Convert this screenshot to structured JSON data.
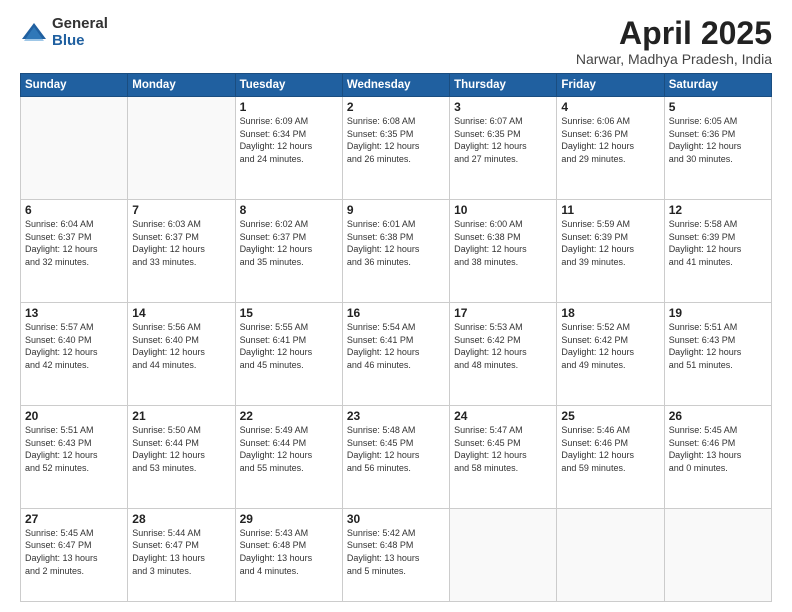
{
  "logo": {
    "general": "General",
    "blue": "Blue"
  },
  "header": {
    "title": "April 2025",
    "location": "Narwar, Madhya Pradesh, India"
  },
  "days_of_week": [
    "Sunday",
    "Monday",
    "Tuesday",
    "Wednesday",
    "Thursday",
    "Friday",
    "Saturday"
  ],
  "weeks": [
    [
      {
        "day": "",
        "info": ""
      },
      {
        "day": "",
        "info": ""
      },
      {
        "day": "1",
        "info": "Sunrise: 6:09 AM\nSunset: 6:34 PM\nDaylight: 12 hours\nand 24 minutes."
      },
      {
        "day": "2",
        "info": "Sunrise: 6:08 AM\nSunset: 6:35 PM\nDaylight: 12 hours\nand 26 minutes."
      },
      {
        "day": "3",
        "info": "Sunrise: 6:07 AM\nSunset: 6:35 PM\nDaylight: 12 hours\nand 27 minutes."
      },
      {
        "day": "4",
        "info": "Sunrise: 6:06 AM\nSunset: 6:36 PM\nDaylight: 12 hours\nand 29 minutes."
      },
      {
        "day": "5",
        "info": "Sunrise: 6:05 AM\nSunset: 6:36 PM\nDaylight: 12 hours\nand 30 minutes."
      }
    ],
    [
      {
        "day": "6",
        "info": "Sunrise: 6:04 AM\nSunset: 6:37 PM\nDaylight: 12 hours\nand 32 minutes."
      },
      {
        "day": "7",
        "info": "Sunrise: 6:03 AM\nSunset: 6:37 PM\nDaylight: 12 hours\nand 33 minutes."
      },
      {
        "day": "8",
        "info": "Sunrise: 6:02 AM\nSunset: 6:37 PM\nDaylight: 12 hours\nand 35 minutes."
      },
      {
        "day": "9",
        "info": "Sunrise: 6:01 AM\nSunset: 6:38 PM\nDaylight: 12 hours\nand 36 minutes."
      },
      {
        "day": "10",
        "info": "Sunrise: 6:00 AM\nSunset: 6:38 PM\nDaylight: 12 hours\nand 38 minutes."
      },
      {
        "day": "11",
        "info": "Sunrise: 5:59 AM\nSunset: 6:39 PM\nDaylight: 12 hours\nand 39 minutes."
      },
      {
        "day": "12",
        "info": "Sunrise: 5:58 AM\nSunset: 6:39 PM\nDaylight: 12 hours\nand 41 minutes."
      }
    ],
    [
      {
        "day": "13",
        "info": "Sunrise: 5:57 AM\nSunset: 6:40 PM\nDaylight: 12 hours\nand 42 minutes."
      },
      {
        "day": "14",
        "info": "Sunrise: 5:56 AM\nSunset: 6:40 PM\nDaylight: 12 hours\nand 44 minutes."
      },
      {
        "day": "15",
        "info": "Sunrise: 5:55 AM\nSunset: 6:41 PM\nDaylight: 12 hours\nand 45 minutes."
      },
      {
        "day": "16",
        "info": "Sunrise: 5:54 AM\nSunset: 6:41 PM\nDaylight: 12 hours\nand 46 minutes."
      },
      {
        "day": "17",
        "info": "Sunrise: 5:53 AM\nSunset: 6:42 PM\nDaylight: 12 hours\nand 48 minutes."
      },
      {
        "day": "18",
        "info": "Sunrise: 5:52 AM\nSunset: 6:42 PM\nDaylight: 12 hours\nand 49 minutes."
      },
      {
        "day": "19",
        "info": "Sunrise: 5:51 AM\nSunset: 6:43 PM\nDaylight: 12 hours\nand 51 minutes."
      }
    ],
    [
      {
        "day": "20",
        "info": "Sunrise: 5:51 AM\nSunset: 6:43 PM\nDaylight: 12 hours\nand 52 minutes."
      },
      {
        "day": "21",
        "info": "Sunrise: 5:50 AM\nSunset: 6:44 PM\nDaylight: 12 hours\nand 53 minutes."
      },
      {
        "day": "22",
        "info": "Sunrise: 5:49 AM\nSunset: 6:44 PM\nDaylight: 12 hours\nand 55 minutes."
      },
      {
        "day": "23",
        "info": "Sunrise: 5:48 AM\nSunset: 6:45 PM\nDaylight: 12 hours\nand 56 minutes."
      },
      {
        "day": "24",
        "info": "Sunrise: 5:47 AM\nSunset: 6:45 PM\nDaylight: 12 hours\nand 58 minutes."
      },
      {
        "day": "25",
        "info": "Sunrise: 5:46 AM\nSunset: 6:46 PM\nDaylight: 12 hours\nand 59 minutes."
      },
      {
        "day": "26",
        "info": "Sunrise: 5:45 AM\nSunset: 6:46 PM\nDaylight: 13 hours\nand 0 minutes."
      }
    ],
    [
      {
        "day": "27",
        "info": "Sunrise: 5:45 AM\nSunset: 6:47 PM\nDaylight: 13 hours\nand 2 minutes."
      },
      {
        "day": "28",
        "info": "Sunrise: 5:44 AM\nSunset: 6:47 PM\nDaylight: 13 hours\nand 3 minutes."
      },
      {
        "day": "29",
        "info": "Sunrise: 5:43 AM\nSunset: 6:48 PM\nDaylight: 13 hours\nand 4 minutes."
      },
      {
        "day": "30",
        "info": "Sunrise: 5:42 AM\nSunset: 6:48 PM\nDaylight: 13 hours\nand 5 minutes."
      },
      {
        "day": "",
        "info": ""
      },
      {
        "day": "",
        "info": ""
      },
      {
        "day": "",
        "info": ""
      }
    ]
  ]
}
